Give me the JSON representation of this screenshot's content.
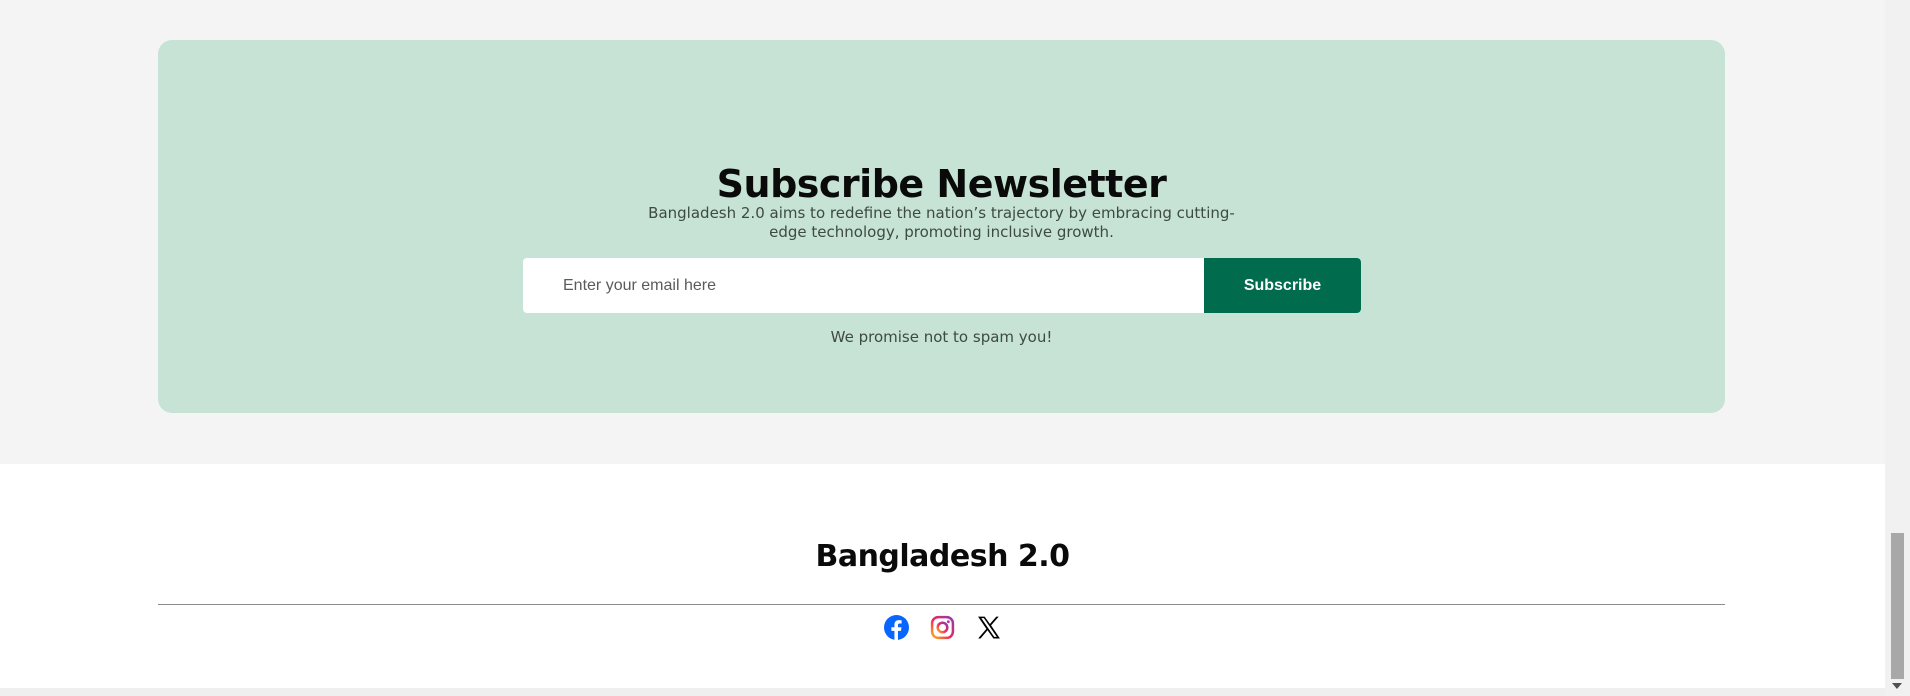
{
  "newsletter": {
    "title": "Subscribe Newsletter",
    "description": "Bangladesh 2.0 aims to redefine the nation’s trajectory by embracing cutting-edge technology, promoting inclusive growth.",
    "email_placeholder": "Enter your email here",
    "email_value": "",
    "subscribe_label": "Subscribe",
    "note": "We promise not to spam you!",
    "background_color": "#c6e3d5",
    "button_color": "#006b4d"
  },
  "footer": {
    "brand": "Bangladesh 2.0",
    "social": [
      {
        "icon": "facebook-icon",
        "color": "#0866ff"
      },
      {
        "icon": "instagram-icon",
        "color": "#e1306c"
      },
      {
        "icon": "x-icon",
        "color": "#000000"
      }
    ]
  }
}
